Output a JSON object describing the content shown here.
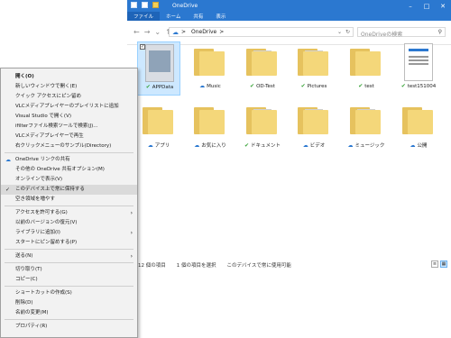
{
  "window": {
    "title": "OneDrive",
    "controls": [
      "–",
      "□",
      "✕"
    ],
    "ribbon_tabs": [
      "ファイル",
      "ホーム",
      "共有",
      "表示"
    ],
    "address": {
      "location": "OneDrive",
      "separator": ">"
    },
    "search": {
      "placeholder": "OneDriveの検索"
    }
  },
  "items": [
    {
      "name": "APPData",
      "type": "image",
      "status": "ok",
      "selected": true
    },
    {
      "name": "Music",
      "type": "folder",
      "status": "cloud"
    },
    {
      "name": "OD-Test",
      "type": "folder-doc",
      "status": "ok"
    },
    {
      "name": "Pictures",
      "type": "folder-doc",
      "status": "ok"
    },
    {
      "name": "test",
      "type": "folder",
      "status": "ok"
    },
    {
      "name": "test151004",
      "type": "doc",
      "status": "ok"
    },
    {
      "name": "アプリ",
      "type": "folder",
      "status": "cloud"
    },
    {
      "name": "お気に入り",
      "type": "folder",
      "status": "cloud"
    },
    {
      "name": "ドキュメント",
      "type": "folder-doc",
      "status": "ok"
    },
    {
      "name": "ビデオ",
      "type": "folder-doc",
      "status": "cloud"
    },
    {
      "name": "ミュージック",
      "type": "folder-doc",
      "status": "cloud"
    },
    {
      "name": "公開",
      "type": "folder",
      "status": "cloud"
    }
  ],
  "status_bar": {
    "count": "12 個の項目",
    "selected": "1 個の項目を選択",
    "availability": "このデバイスで常に使用可能"
  },
  "context_menu": [
    {
      "label": "開く(O)",
      "bold": true
    },
    {
      "label": "新しいウィンドウで開く(E)"
    },
    {
      "label": "クイック アクセスにピン留め"
    },
    {
      "label": "VLCメディアプレイヤーのプレイリストに追加"
    },
    {
      "label": "Visual Studio で開く(V)"
    },
    {
      "label": "ifilterファイル検索ツールで検索(J)..."
    },
    {
      "label": "VLCメディアプレイヤーで再生"
    },
    {
      "label": "右クリックメニューのサンプル(Directory)"
    },
    {
      "sep": true
    },
    {
      "label": "OneDrive リンクの共有",
      "icon": "cloud"
    },
    {
      "label": "その他の OneDrive 共有オプション(M)"
    },
    {
      "label": "オンラインで表示(V)"
    },
    {
      "label": "このデバイス上で常に保持する",
      "icon": "check",
      "highlight": true
    },
    {
      "label": "空き領域を増やす"
    },
    {
      "sep": true
    },
    {
      "label": "アクセスを許可する(G)",
      "arrow": true
    },
    {
      "label": "以前のバージョンの復元(V)"
    },
    {
      "label": "ライブラリに追加(I)",
      "arrow": true
    },
    {
      "label": "スタートにピン留めする(P)"
    },
    {
      "sep": true
    },
    {
      "label": "送る(N)",
      "arrow": true
    },
    {
      "sep": true
    },
    {
      "label": "切り取り(T)"
    },
    {
      "label": "コピー(C)"
    },
    {
      "sep": true
    },
    {
      "label": "ショートカットの作成(S)"
    },
    {
      "label": "削除(D)"
    },
    {
      "label": "名前の変更(M)"
    },
    {
      "sep": true
    },
    {
      "label": "プロパティ(R)"
    }
  ],
  "colors": {
    "accent": "#2b78d0",
    "folder": "#f4d77a",
    "synced": "#3aa43a",
    "selection": "#cde8ff"
  }
}
